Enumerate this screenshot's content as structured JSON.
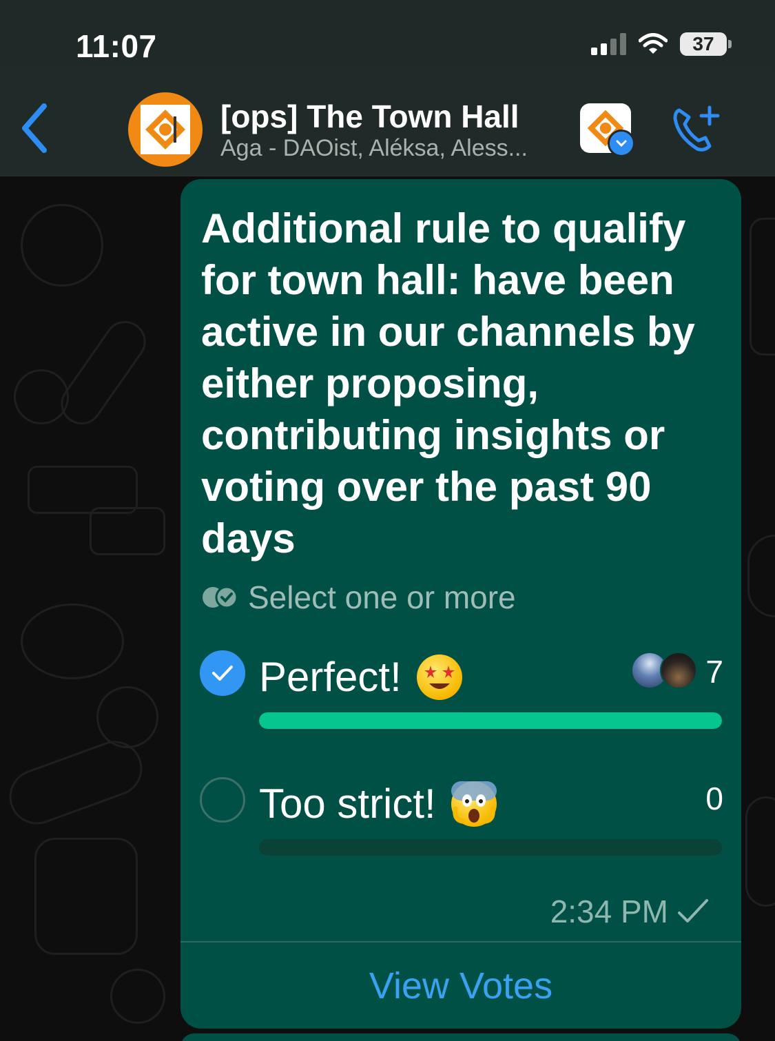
{
  "status_bar": {
    "time": "11:07",
    "battery": "37"
  },
  "header": {
    "title": "[ops] The Town Hall",
    "subtitle": "Aga - DAOist, Aléksa, Aless..."
  },
  "poll": {
    "question": "Additional rule to qualify for town hall: have been active in our channels by either proposing, contributing insights or voting over the past 90 days",
    "hint": "Select one or more",
    "options": [
      {
        "label": "Perfect!",
        "emoji": "star-struck",
        "count": "7",
        "selected": true,
        "fraction": 1.0
      },
      {
        "label": "Too strict!",
        "emoji": "screaming-face",
        "count": "0",
        "selected": false,
        "fraction": 0.0
      }
    ],
    "time": "2:34 PM",
    "view_votes": "View Votes"
  },
  "colors": {
    "bubble": "#015046",
    "bar_fill": "#06c58e",
    "accent_blue": "#3296f5",
    "link_blue": "#3ba1f3",
    "avatar_orange": "#f08a14"
  },
  "icons": [
    "back-chevron-icon",
    "group-avatar-icon",
    "community-icon",
    "add-call-icon",
    "double-check-icon",
    "checkmark-icon",
    "signal-icon",
    "wifi-icon",
    "battery-icon"
  ]
}
